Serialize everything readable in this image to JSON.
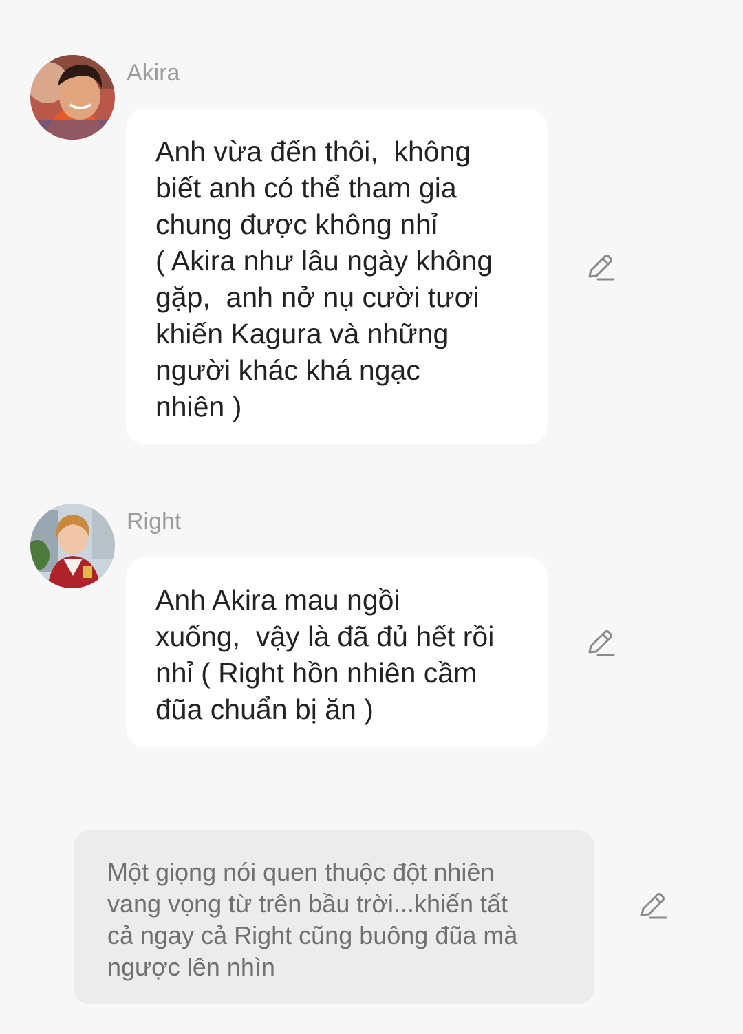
{
  "messages": [
    {
      "name": "Akira",
      "text": "Anh vừa đến thôi,  không\nbiết anh có thể tham gia\nchung được không nhỉ\n( Akira như lâu ngày không\ngặp,  anh nở nụ cười tươi\nkhiến Kagura và những\nngười khác khá ngạc\nnhiên )",
      "edit_icon": "pencil-icon"
    },
    {
      "name": "Right",
      "text": "Anh Akira mau ngồi\nxuống,  vậy là đã đủ hết rồi\nnhỉ ( Right hồn nhiên cầm\nđũa chuẩn bị ăn )",
      "edit_icon": "pencil-icon"
    }
  ],
  "narration": {
    "text": "Một giọng nói quen thuộc đột nhiên\nvang vọng từ trên bầu trời...khiến tất\ncả ngay cả Right cũng buông đũa mà\nngược lên nhìn",
    "edit_icon": "pencil-icon"
  },
  "colors": {
    "background": "#f7f7f7",
    "bubble": "#ffffff",
    "narration_bg": "#ececec",
    "name_text": "#9a9a9a",
    "icon": "#8a8a8a"
  }
}
